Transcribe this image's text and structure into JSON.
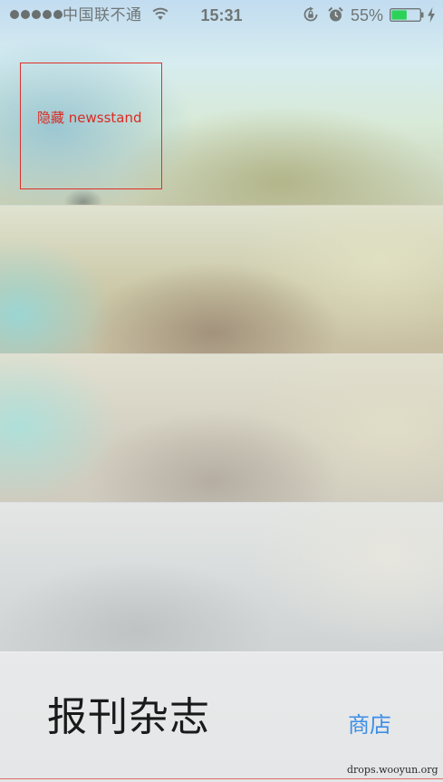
{
  "status_bar": {
    "signal_bars": 5,
    "carrier": "中国联不通",
    "time": "15:31",
    "battery_percent": "55%",
    "battery_level": 0.55,
    "icons": [
      "wifi-icon",
      "rotation-lock-icon",
      "alarm-icon",
      "battery-icon",
      "charging-icon"
    ],
    "battery_color": "#2bd25a"
  },
  "annotation": {
    "label": "隐藏 newsstand",
    "color": "#e0312a"
  },
  "bottom_bar": {
    "title": "报刊杂志",
    "store_label": "商店",
    "store_color": "#3d8ee8"
  },
  "watermark": "drops.wooyun.org"
}
